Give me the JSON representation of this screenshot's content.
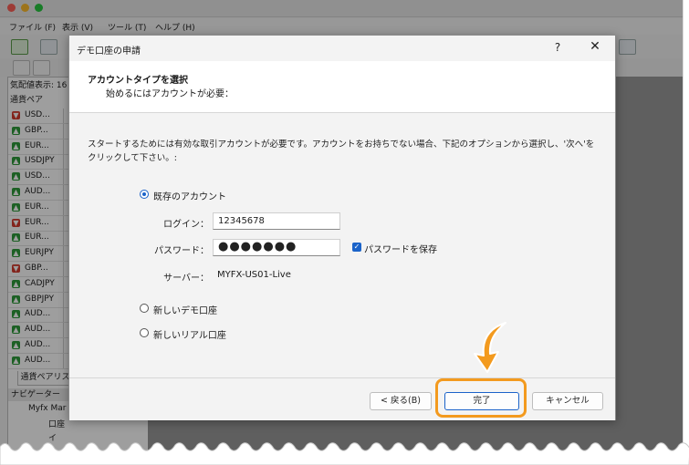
{
  "menubar": [
    "ファイル (F)",
    "表示 (V)",
    "ツール (T)",
    "ヘルプ (H)"
  ],
  "left_panel": {
    "price_label": "気配値表示: 16",
    "col_header": "通貨ペア",
    "pairs": [
      {
        "sym": "USD...",
        "dir": "dn"
      },
      {
        "sym": "GBP...",
        "dir": "up"
      },
      {
        "sym": "EUR...",
        "dir": "up"
      },
      {
        "sym": "USDJPY",
        "dir": "up"
      },
      {
        "sym": "USD...",
        "dir": "up"
      },
      {
        "sym": "AUD...",
        "dir": "up"
      },
      {
        "sym": "EUR...",
        "dir": "up"
      },
      {
        "sym": "EUR...",
        "dir": "dn"
      },
      {
        "sym": "EUR...",
        "dir": "up"
      },
      {
        "sym": "EURJPY",
        "dir": "up"
      },
      {
        "sym": "GBP...",
        "dir": "dn"
      },
      {
        "sym": "CADJPY",
        "dir": "up"
      },
      {
        "sym": "GBPJPY",
        "dir": "up"
      },
      {
        "sym": "AUD...",
        "dir": "up"
      },
      {
        "sym": "AUD...",
        "dir": "up"
      },
      {
        "sym": "AUD...",
        "dir": "up"
      },
      {
        "sym": "AUD...",
        "dir": "up"
      }
    ],
    "tab_label": "通貨ペアリスト",
    "navigator_label": "ナビゲーター",
    "nav_items": [
      "Myfx Mar",
      "口座",
      "イ"
    ]
  },
  "dialog": {
    "title": "デモ口座の申請",
    "help": "?",
    "close": "✕",
    "heading": "アカウントタイプを選択",
    "subheading": "始めるにはアカウントが必要：",
    "desc_line1": "スタートするためには有効な取引アカウントが必要です。アカウントをお持ちでない場合、下記のオプションから選択し、'次へ'を",
    "desc_line2": "クリックして下さい。:",
    "radio_existing": "既存のアカウント",
    "login_label": "ログイン：",
    "login_value": "12345678",
    "password_label": "パスワード：",
    "password_value": "●●●●●●●",
    "save_password": "パスワードを保存",
    "server_label": "サーバー：",
    "server_value": "MYFX-US01-Live",
    "radio_new_demo": "新しいデモ口座",
    "radio_new_real": "新しいリアル口座",
    "back_button": "< 戻る(B)",
    "finish_button": "完了",
    "cancel_button": "キャンセル"
  },
  "colors": {
    "highlight_ring": "#f39a1e",
    "accent_blue": "#1b63c9"
  }
}
